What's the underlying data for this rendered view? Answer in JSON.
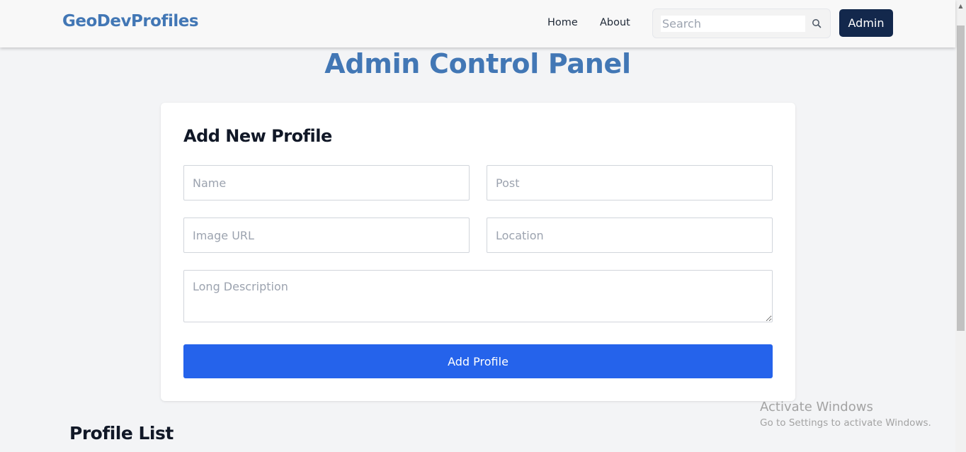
{
  "nav": {
    "brand": "GeoDevProfiles",
    "links": [
      "Home",
      "About"
    ],
    "search_placeholder": "Search",
    "admin_label": "Admin"
  },
  "main": {
    "title": "Admin Control Panel",
    "form": {
      "title": "Add New Profile",
      "name_placeholder": "Name",
      "post_placeholder": "Post",
      "image_placeholder": "Image URL",
      "location_placeholder": "Location",
      "description_placeholder": "Long Description",
      "submit_label": "Add Profile"
    },
    "list_title": "Profile List"
  },
  "watermark": {
    "title": "Activate Windows",
    "subtitle": "Go to Settings to activate Windows."
  },
  "colors": {
    "brand": "#4277b5",
    "admin_button": "#13284c",
    "primary_button": "#2563eb",
    "page_background": "#f3f4f6"
  },
  "icons": {
    "search": "search-icon",
    "scroll_up": "scroll-up-arrow-icon"
  }
}
